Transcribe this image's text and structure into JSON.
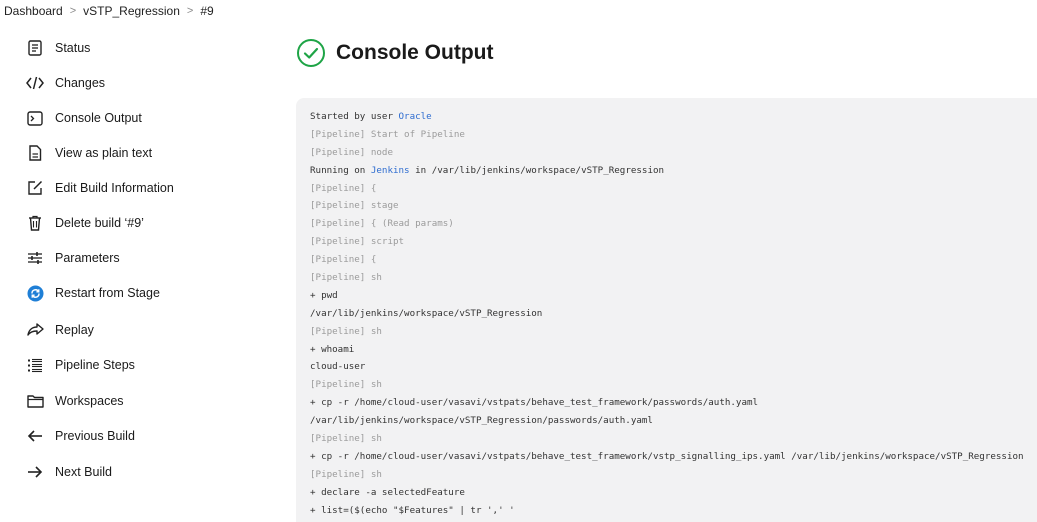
{
  "breadcrumb": {
    "items": [
      "Dashboard",
      "vSTP_Regression",
      "#9"
    ],
    "separator": ">"
  },
  "sidebar": {
    "items": [
      {
        "label": "Status",
        "icon": "status-icon"
      },
      {
        "label": "Changes",
        "icon": "code-icon"
      },
      {
        "label": "Console Output",
        "icon": "terminal-icon"
      },
      {
        "label": "View as plain text",
        "icon": "document-icon"
      },
      {
        "label": "Edit Build Information",
        "icon": "edit-icon"
      },
      {
        "label": "Delete build ‘#9’",
        "icon": "trash-icon"
      },
      {
        "label": "Parameters",
        "icon": "sliders-icon"
      },
      {
        "label": "Restart from Stage",
        "icon": "restart-icon"
      },
      {
        "label": "Replay",
        "icon": "replay-icon"
      },
      {
        "label": "Pipeline Steps",
        "icon": "list-icon"
      },
      {
        "label": "Workspaces",
        "icon": "folder-icon"
      },
      {
        "label": "Previous Build",
        "icon": "arrow-left-icon"
      },
      {
        "label": "Next Build",
        "icon": "arrow-right-icon"
      }
    ]
  },
  "page": {
    "title": "Console Output"
  },
  "colors": {
    "success_green": "#1ea446",
    "link_blue": "#2f6dd0",
    "console_bg": "#f2f2f3",
    "restart_blue": "#1f7fd6"
  },
  "console": {
    "lines": [
      {
        "text": "Started by user ",
        "link": "Oracle",
        "after": "",
        "kind": "normal"
      },
      {
        "text": "[Pipeline] Start of Pipeline",
        "kind": "pipeline"
      },
      {
        "text": "[Pipeline] node",
        "kind": "pipeline"
      },
      {
        "text": "Running on ",
        "link": "Jenkins",
        "after": " in /var/lib/jenkins/workspace/vSTP_Regression",
        "kind": "normal"
      },
      {
        "text": "[Pipeline] {",
        "kind": "pipeline"
      },
      {
        "text": "[Pipeline] stage",
        "kind": "pipeline"
      },
      {
        "text": "[Pipeline] { (Read params)",
        "kind": "pipeline"
      },
      {
        "text": "[Pipeline] script",
        "kind": "pipeline"
      },
      {
        "text": "[Pipeline] {",
        "kind": "pipeline"
      },
      {
        "text": "[Pipeline] sh",
        "kind": "pipeline"
      },
      {
        "text": "+ pwd",
        "kind": "normal"
      },
      {
        "text": "/var/lib/jenkins/workspace/vSTP_Regression",
        "kind": "normal"
      },
      {
        "text": "[Pipeline] sh",
        "kind": "pipeline"
      },
      {
        "text": "+ whoami",
        "kind": "normal"
      },
      {
        "text": "cloud-user",
        "kind": "normal"
      },
      {
        "text": "[Pipeline] sh",
        "kind": "pipeline"
      },
      {
        "text": "+ cp -r /home/cloud-user/vasavi/vstpats/behave_test_framework/passwords/auth.yaml",
        "kind": "normal"
      },
      {
        "text": "/var/lib/jenkins/workspace/vSTP_Regression/passwords/auth.yaml",
        "kind": "normal"
      },
      {
        "text": "[Pipeline] sh",
        "kind": "pipeline"
      },
      {
        "text": "+ cp -r /home/cloud-user/vasavi/vstpats/behave_test_framework/vstp_signalling_ips.yaml /var/lib/jenkins/workspace/vSTP_Regression",
        "kind": "normal"
      },
      {
        "text": "[Pipeline] sh",
        "kind": "pipeline"
      },
      {
        "text": "+ declare -a selectedFeature",
        "kind": "normal"
      },
      {
        "text": "+ list=($(echo \"$Features\" | tr ',' '",
        "kind": "normal"
      },
      {
        "text": "'))",
        "kind": "normal"
      }
    ]
  }
}
